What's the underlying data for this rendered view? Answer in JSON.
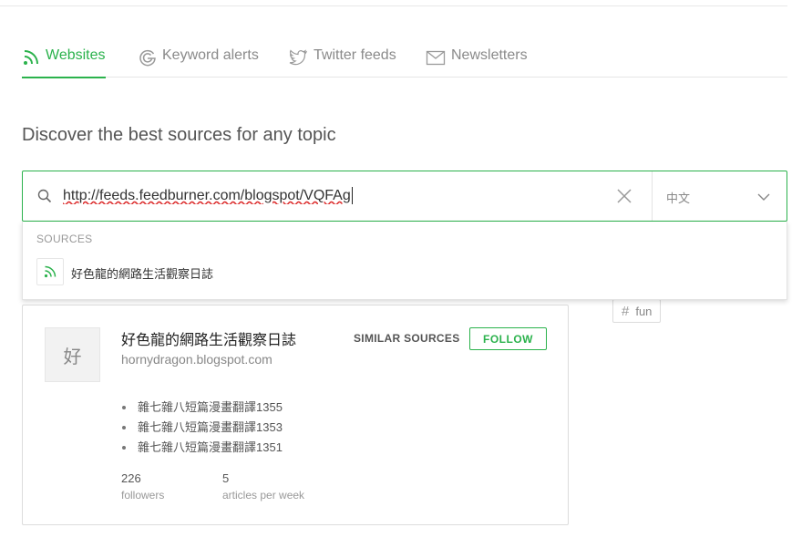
{
  "tabs": [
    {
      "label": "Websites",
      "icon": "rss-icon",
      "active": true
    },
    {
      "label": "Keyword alerts",
      "icon": "google-icon",
      "active": false
    },
    {
      "label": "Twitter feeds",
      "icon": "twitter-icon",
      "active": false
    },
    {
      "label": "Newsletters",
      "icon": "envelope-icon",
      "active": false
    }
  ],
  "headline": "Discover the best sources for any topic",
  "search": {
    "value": "http://feeds.feedburner.com/blogspot/VQFAg",
    "language": "中文"
  },
  "dropdown": {
    "section_label": "SOURCES",
    "suggestions": [
      {
        "label": "好色龍的網路生活觀察日誌",
        "icon": "rss-icon"
      }
    ]
  },
  "source_card": {
    "avatar_letter": "好",
    "title": "好色龍的網路生活觀察日誌",
    "domain": "hornydragon.blogspot.com",
    "similar_label": "SIMILAR SOURCES",
    "follow_label": "FOLLOW",
    "articles": [
      "雜七雜八短篇漫畫翻譯1355",
      "雜七雜八短篇漫畫翻譯1353",
      "雜七雜八短篇漫畫翻譯1351"
    ],
    "stats": [
      {
        "value": "226",
        "label": "followers"
      },
      {
        "value": "5",
        "label": "articles per week"
      }
    ]
  },
  "tag": {
    "label": "fun"
  },
  "colors": {
    "accent": "#2bb24c",
    "border": "#dcdcdc",
    "muted_text": "#888888"
  }
}
